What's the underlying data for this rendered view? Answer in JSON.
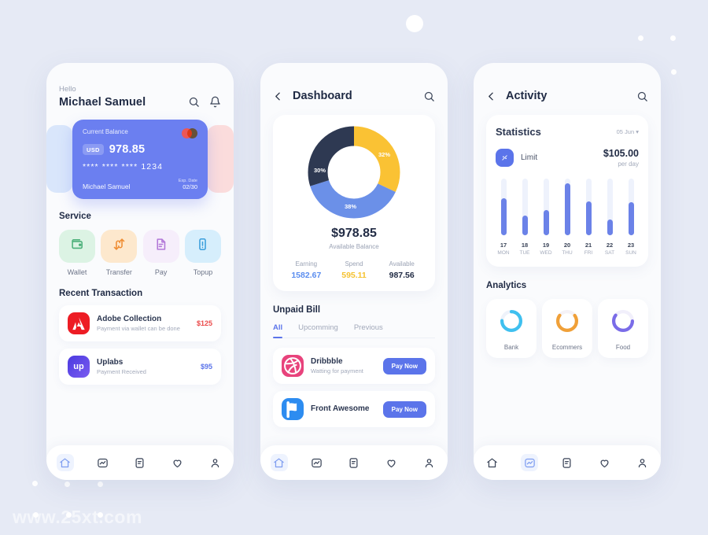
{
  "background": {
    "watermark": "www.25xt.com"
  },
  "screen1": {
    "hello": "Hello",
    "user_name": "Michael Samuel",
    "icons": {
      "search": "search-icon",
      "bell": "bell-icon"
    },
    "card": {
      "label": "Current Balance",
      "currency": "USD",
      "amount": "978.85",
      "number_masked": "**** **** ****",
      "number_last4": "1234",
      "holder": "Michael Samuel",
      "exp_label": "Exp. Date",
      "exp_value": "02/30",
      "color": "#6b7ff0"
    },
    "service_title": "Service",
    "services": [
      {
        "label": "Wallet",
        "icon": "wallet-icon",
        "bg": "#dcf3e4",
        "fg": "#4cb07a"
      },
      {
        "label": "Transfer",
        "icon": "transfer-icon",
        "bg": "#fde8cd",
        "fg": "#ef8c32"
      },
      {
        "label": "Pay",
        "icon": "pay-icon",
        "bg": "#f6eefb",
        "fg": "#b277d8"
      },
      {
        "label": "Topup",
        "icon": "topup-icon",
        "bg": "#d6eefc",
        "fg": "#3b9fdc"
      }
    ],
    "recent_title": "Recent Transaction",
    "transactions": [
      {
        "name": "Adobe Collection",
        "sub": "Payment via wallet can be done",
        "amount": "$125",
        "amount_color": "#eb4b4b",
        "icon_text": "A",
        "icon_bg": "#ed1c24"
      },
      {
        "name": "Uplabs",
        "sub": "Payment Received",
        "amount": "$95",
        "amount_color": "#5b74ea",
        "icon_text": "up",
        "icon_bg": "#4a3ae0"
      }
    ],
    "nav": [
      {
        "icon": "home-icon",
        "active": true
      },
      {
        "icon": "analytics-icon",
        "active": false
      },
      {
        "icon": "document-icon",
        "active": false
      },
      {
        "icon": "heart-icon",
        "active": false
      },
      {
        "icon": "profile-icon",
        "active": false
      }
    ]
  },
  "screen2": {
    "title": "Dashboard",
    "back_icon": "chevron-left-icon",
    "search_icon": "search-icon",
    "balance_amount": "$978.85",
    "balance_label": "Available Balance",
    "stats": [
      {
        "key": "Earning",
        "value": "1582.67",
        "color": "#5b8def"
      },
      {
        "key": "Spend",
        "value": "595.11",
        "color": "#f5c230"
      },
      {
        "key": "Available",
        "value": "987.56",
        "color": "#222c45"
      }
    ],
    "unpaid_title": "Unpaid Bill",
    "tabs": [
      {
        "label": "All",
        "active": true
      },
      {
        "label": "Upcomming",
        "active": false
      },
      {
        "label": "Previous",
        "active": false
      }
    ],
    "bills": [
      {
        "name": "Dribbble",
        "sub": "Watting for payment",
        "button": "Pay Now",
        "icon": "dribbble-icon",
        "icon_bg": "#e8437c"
      },
      {
        "name": "Front Awesome",
        "sub": "",
        "button": "Pay Now",
        "icon": "font-awesome-icon",
        "icon_bg": "#2d8cf0"
      }
    ],
    "nav": [
      {
        "icon": "home-icon",
        "active": true
      },
      {
        "icon": "analytics-icon",
        "active": false
      },
      {
        "icon": "document-icon",
        "active": false
      },
      {
        "icon": "heart-icon",
        "active": false
      },
      {
        "icon": "profile-icon",
        "active": false
      }
    ],
    "chart_data": {
      "type": "pie",
      "title": "Balance breakdown",
      "categories": [
        "Yellow segment",
        "Blue segment",
        "Dark segment"
      ],
      "values": [
        32,
        38,
        30
      ],
      "labels": [
        "32%",
        "38%",
        "30%"
      ],
      "colors": [
        "#fac234",
        "#6b90e8",
        "#2e3952"
      ],
      "center_text": "$978.85",
      "legend": "none"
    }
  },
  "screen3": {
    "title": "Activity",
    "back_icon": "chevron-left-icon",
    "search_icon": "search-icon",
    "stat_title": "Statistics",
    "stat_date": "05 Jun",
    "limit_label": "Limit",
    "limit_icon": "limit-icon",
    "limit_amount": "$105.00",
    "limit_per": "per day",
    "analytics_title": "Analytics",
    "analytics": [
      {
        "label": "Bank",
        "percent": 75,
        "color": "#3fc0ef"
      },
      {
        "label": "Ecommers",
        "percent": 70,
        "color": "#f0a038"
      },
      {
        "label": "Food",
        "percent": 60,
        "color": "#7a6ce8"
      }
    ],
    "nav": [
      {
        "icon": "home-icon",
        "active": false
      },
      {
        "icon": "analytics-icon",
        "active": true
      },
      {
        "icon": "document-icon",
        "active": false
      },
      {
        "icon": "heart-icon",
        "active": false
      },
      {
        "icon": "profile-icon",
        "active": false
      }
    ],
    "chart_data": {
      "type": "bar",
      "title": "Statistics",
      "xlabel": "",
      "ylabel": "",
      "categories": [
        "17",
        "18",
        "19",
        "20",
        "21",
        "22",
        "23"
      ],
      "weekdays": [
        "MON",
        "TUE",
        "WED",
        "THU",
        "FRI",
        "SAT",
        "SUN"
      ],
      "values": [
        65,
        35,
        45,
        92,
        60,
        28,
        58
      ],
      "ylim": [
        0,
        100
      ],
      "grid": false,
      "bar_color": "#6b82e8",
      "track_color": "#eef2fc"
    }
  }
}
